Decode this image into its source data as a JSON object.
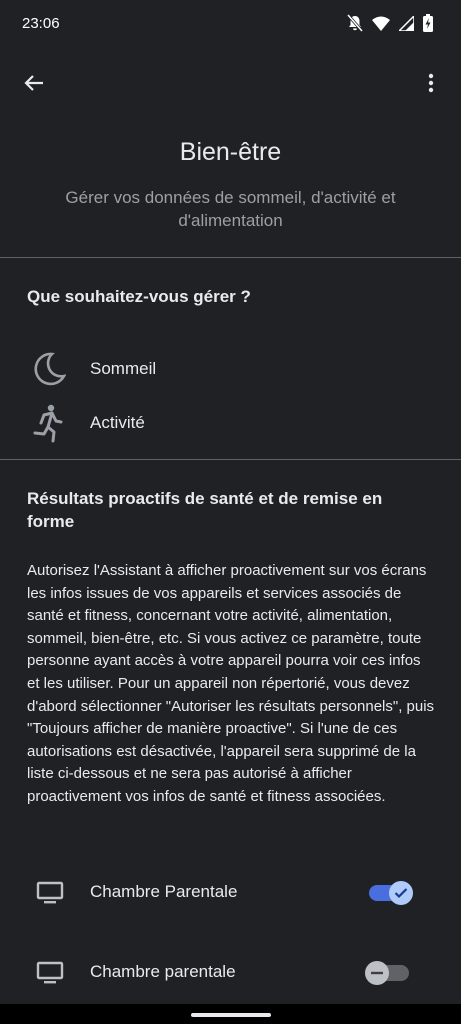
{
  "status_bar": {
    "time": "23:06",
    "icons": [
      "notifications-off-icon",
      "wifi-icon",
      "cell-signal-icon",
      "battery-charging-icon"
    ]
  },
  "app_bar": {
    "back_icon": "arrow-back-icon",
    "more_icon": "more-vert-icon"
  },
  "page": {
    "title": "Bien-être",
    "subtitle": "Gérer vos données de sommeil, d'activité et d'alimentation"
  },
  "manage_section": {
    "heading": "Que souhaitez-vous gérer ?",
    "items": [
      {
        "label": "Sommeil",
        "icon": "moon-icon"
      },
      {
        "label": "Activité",
        "icon": "running-person-icon"
      }
    ]
  },
  "proactive_section": {
    "heading": "Résultats proactifs de santé et de remise en forme",
    "description": "Autorisez l'Assistant à afficher proactivement sur vos écrans les infos issues de vos appareils et services associés de santé et fitness, concernant votre activité, alimentation, sommeil, bien-être, etc. Si vous activez ce paramètre, toute personne ayant accès à votre appareil pourra voir ces infos et les utiliser. Pour un appareil non répertorié, vous devez d'abord sélectionner \"Autoriser les résultats personnels\", puis \"Toujours afficher de manière proactive\". Si l'une de ces autorisations est désactivée, l'appareil sera supprimé de la liste ci-dessous et ne sera pas autorisé à afficher proactivement vos infos de santé et fitness associées.",
    "devices": [
      {
        "label": "Chambre Parentale",
        "icon": "monitor-icon",
        "enabled": true
      },
      {
        "label": "Chambre parentale",
        "icon": "monitor-icon",
        "enabled": false
      }
    ]
  },
  "colors": {
    "background": "#202124",
    "toggle_on": "#4a6ee0",
    "toggle_thumb_on": "#aecbfa",
    "toggle_off": "#5f6368"
  }
}
